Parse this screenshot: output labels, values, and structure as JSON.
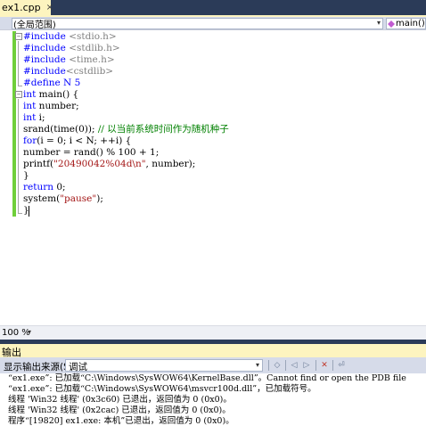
{
  "tab": {
    "label": "ex1.cpp",
    "close_icon": "×"
  },
  "navbar": {
    "scope": "(全局范围)",
    "member": "main()"
  },
  "code_lines": [
    [
      "#include ",
      "<stdio.h>"
    ],
    [
      "#include ",
      "<stdlib.h>"
    ],
    [
      "#include ",
      "<time.h>"
    ],
    [
      "#include",
      "<cstdlib>"
    ],
    [
      "#define N 5"
    ],
    [
      "int",
      " main() {"
    ],
    [
      "int",
      " number;"
    ],
    [
      "int",
      " i;"
    ],
    [
      "srand(time(0)); ",
      "// 以当前系统时间作为随机种子"
    ],
    [
      "for",
      "(i = 0; i < N; ++i) {"
    ],
    [
      "number = rand() % 100 + 1;"
    ],
    [
      "printf(",
      "\"20490042%04d\\n\"",
      ", number);"
    ],
    [
      "}"
    ],
    [
      "return",
      " 0;"
    ],
    [
      "system(",
      "\"pause\"",
      ");"
    ],
    [
      "}"
    ]
  ],
  "zoom": {
    "level": "100 %"
  },
  "output": {
    "title": "输出",
    "source_label": "显示输出来源(S):",
    "source_value": "调试",
    "lines": [
      "“ex1.exe”: 已加载“C:\\Windows\\SysWOW64\\KernelBase.dll”。Cannot find or open the PDB file",
      "“ex1.exe”: 已加载“C:\\Windows\\SysWOW64\\msvcr100d.dll”，已加载符号。",
      "线程 'Win32 线程' (0x3c60) 已退出，返回值为 0 (0x0)。",
      "线程 'Win32 线程' (0x2cac) 已退出，返回值为 0 (0x0)。",
      "程序“[19820] ex1.exe: 本机”已退出，返回值为 0 (0x0)。"
    ]
  },
  "colors": {
    "keyword": "#0000ff",
    "preprocessor": "#808080",
    "string": "#a31515",
    "comment": "#008000",
    "tab_active": "#fdf4bf",
    "chrome_dark": "#2b3b58"
  }
}
